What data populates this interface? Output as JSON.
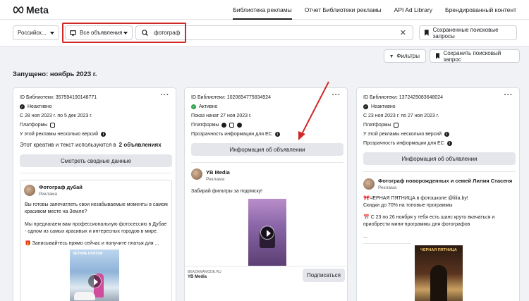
{
  "nav": {
    "logo_text": "Meta",
    "links": [
      "Библиотека рекламы",
      "Отчет Библиотеки рекламы",
      "API Ad Library",
      "Брендированный контент"
    ]
  },
  "search": {
    "country": "Российск...",
    "ad_type": "Все объявления",
    "query": "фотограф",
    "saved_searches": "Сохраненные поисковые запросы"
  },
  "actions": {
    "filters": "Фильтры",
    "save_query": "Сохранить поисковый запрос"
  },
  "section_title": "Запущено: ноябрь 2023 г.",
  "cards": [
    {
      "library_id": "ID Библиотеки: 357594190148771",
      "status": "Неактивно",
      "dates": "С 28 ноя 2023 г. по 5 дек 2023 г.",
      "platforms": "Платформы",
      "versions": "У этой рекламы несколько версий",
      "creative_note": "Этот креатив и текст используются в",
      "creative_count": "2 объявлениях",
      "button": "Смотреть сводные данные",
      "advertiser": "Фотограф дубай",
      "sponsored": "Реклама",
      "text1": "Вы готовы запечатлеть свои незабываемые моменты в самом красивом месте на Земле?",
      "text2": "Мы предлагаем вам профессиональную фотосессию в Дубае - одном из самых красивых и интересных городов в мире.",
      "text3": "Записывайтесь прямо сейчас и получите платья для ...",
      "image_caption": "ЛЕТНИЕ ПЛАТЬЯ"
    },
    {
      "library_id": "ID Библиотеки: 1020654775834924",
      "status": "Активно",
      "dates": "Показ начат 27 ноя 2023 г.",
      "platforms": "Платформы",
      "transparency": "Прозрачность информации для ЕС",
      "button": "Информация об объявлении",
      "advertiser": "YB Media",
      "sponsored": "Реклама",
      "text1": "Забирай фильтры за подписку!",
      "footer_domain": "BEAZAWAMODE.RU",
      "footer_name": "YB Media",
      "cta": "Подписаться"
    },
    {
      "library_id": "ID Библиотеки: 1372425083648024",
      "status": "Неактивно",
      "dates": "С 23 ноя 2023 г. по 27 ноя 2023 г.",
      "platforms": "Платформы",
      "versions": "У этой рекламы несколько версий",
      "transparency": "Прозрачность информации для ЕС",
      "button": "Информация об объявлении",
      "advertiser": "Фотограф новорожденных и семей Лилия Стасеня",
      "sponsored": "Реклама",
      "text1": "🎀ЧЕРНАЯ ПЯТНИЦА в фотошколе @lilia.by!",
      "text2": "Скидки до 70% на топовые программы",
      "text3": "📅 С 23 по 26 ноября у тебя есть шанс круто вкачаться и приобрести мини-программы для фотографов",
      "text4": "...",
      "image_caption": "ЧЕРНАЯ ПЯТНИЦА"
    }
  ],
  "colors": {
    "highlight": "#d12727",
    "active_green": "#31a24c",
    "button_gray": "#e4e6eb"
  }
}
